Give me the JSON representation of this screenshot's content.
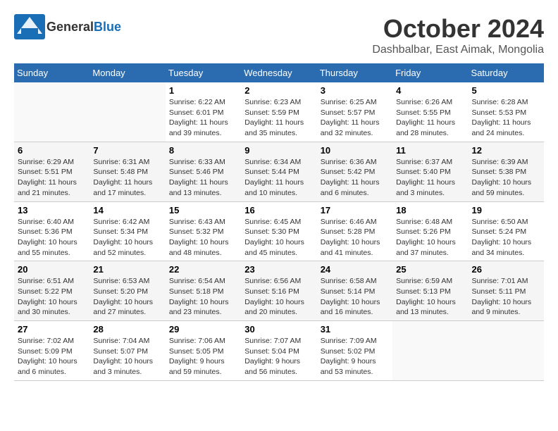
{
  "logo": {
    "general": "General",
    "blue": "Blue"
  },
  "title": "October 2024",
  "location": "Dashbalbar, East Aimak, Mongolia",
  "days_header": [
    "Sunday",
    "Monday",
    "Tuesday",
    "Wednesday",
    "Thursday",
    "Friday",
    "Saturday"
  ],
  "weeks": [
    [
      {
        "day": "",
        "info": ""
      },
      {
        "day": "",
        "info": ""
      },
      {
        "day": "1",
        "info": "Sunrise: 6:22 AM\nSunset: 6:01 PM\nDaylight: 11 hours\nand 39 minutes."
      },
      {
        "day": "2",
        "info": "Sunrise: 6:23 AM\nSunset: 5:59 PM\nDaylight: 11 hours\nand 35 minutes."
      },
      {
        "day": "3",
        "info": "Sunrise: 6:25 AM\nSunset: 5:57 PM\nDaylight: 11 hours\nand 32 minutes."
      },
      {
        "day": "4",
        "info": "Sunrise: 6:26 AM\nSunset: 5:55 PM\nDaylight: 11 hours\nand 28 minutes."
      },
      {
        "day": "5",
        "info": "Sunrise: 6:28 AM\nSunset: 5:53 PM\nDaylight: 11 hours\nand 24 minutes."
      }
    ],
    [
      {
        "day": "6",
        "info": "Sunrise: 6:29 AM\nSunset: 5:51 PM\nDaylight: 11 hours\nand 21 minutes."
      },
      {
        "day": "7",
        "info": "Sunrise: 6:31 AM\nSunset: 5:48 PM\nDaylight: 11 hours\nand 17 minutes."
      },
      {
        "day": "8",
        "info": "Sunrise: 6:33 AM\nSunset: 5:46 PM\nDaylight: 11 hours\nand 13 minutes."
      },
      {
        "day": "9",
        "info": "Sunrise: 6:34 AM\nSunset: 5:44 PM\nDaylight: 11 hours\nand 10 minutes."
      },
      {
        "day": "10",
        "info": "Sunrise: 6:36 AM\nSunset: 5:42 PM\nDaylight: 11 hours\nand 6 minutes."
      },
      {
        "day": "11",
        "info": "Sunrise: 6:37 AM\nSunset: 5:40 PM\nDaylight: 11 hours\nand 3 minutes."
      },
      {
        "day": "12",
        "info": "Sunrise: 6:39 AM\nSunset: 5:38 PM\nDaylight: 10 hours\nand 59 minutes."
      }
    ],
    [
      {
        "day": "13",
        "info": "Sunrise: 6:40 AM\nSunset: 5:36 PM\nDaylight: 10 hours\nand 55 minutes."
      },
      {
        "day": "14",
        "info": "Sunrise: 6:42 AM\nSunset: 5:34 PM\nDaylight: 10 hours\nand 52 minutes."
      },
      {
        "day": "15",
        "info": "Sunrise: 6:43 AM\nSunset: 5:32 PM\nDaylight: 10 hours\nand 48 minutes."
      },
      {
        "day": "16",
        "info": "Sunrise: 6:45 AM\nSunset: 5:30 PM\nDaylight: 10 hours\nand 45 minutes."
      },
      {
        "day": "17",
        "info": "Sunrise: 6:46 AM\nSunset: 5:28 PM\nDaylight: 10 hours\nand 41 minutes."
      },
      {
        "day": "18",
        "info": "Sunrise: 6:48 AM\nSunset: 5:26 PM\nDaylight: 10 hours\nand 37 minutes."
      },
      {
        "day": "19",
        "info": "Sunrise: 6:50 AM\nSunset: 5:24 PM\nDaylight: 10 hours\nand 34 minutes."
      }
    ],
    [
      {
        "day": "20",
        "info": "Sunrise: 6:51 AM\nSunset: 5:22 PM\nDaylight: 10 hours\nand 30 minutes."
      },
      {
        "day": "21",
        "info": "Sunrise: 6:53 AM\nSunset: 5:20 PM\nDaylight: 10 hours\nand 27 minutes."
      },
      {
        "day": "22",
        "info": "Sunrise: 6:54 AM\nSunset: 5:18 PM\nDaylight: 10 hours\nand 23 minutes."
      },
      {
        "day": "23",
        "info": "Sunrise: 6:56 AM\nSunset: 5:16 PM\nDaylight: 10 hours\nand 20 minutes."
      },
      {
        "day": "24",
        "info": "Sunrise: 6:58 AM\nSunset: 5:14 PM\nDaylight: 10 hours\nand 16 minutes."
      },
      {
        "day": "25",
        "info": "Sunrise: 6:59 AM\nSunset: 5:13 PM\nDaylight: 10 hours\nand 13 minutes."
      },
      {
        "day": "26",
        "info": "Sunrise: 7:01 AM\nSunset: 5:11 PM\nDaylight: 10 hours\nand 9 minutes."
      }
    ],
    [
      {
        "day": "27",
        "info": "Sunrise: 7:02 AM\nSunset: 5:09 PM\nDaylight: 10 hours\nand 6 minutes."
      },
      {
        "day": "28",
        "info": "Sunrise: 7:04 AM\nSunset: 5:07 PM\nDaylight: 10 hours\nand 3 minutes."
      },
      {
        "day": "29",
        "info": "Sunrise: 7:06 AM\nSunset: 5:05 PM\nDaylight: 9 hours\nand 59 minutes."
      },
      {
        "day": "30",
        "info": "Sunrise: 7:07 AM\nSunset: 5:04 PM\nDaylight: 9 hours\nand 56 minutes."
      },
      {
        "day": "31",
        "info": "Sunrise: 7:09 AM\nSunset: 5:02 PM\nDaylight: 9 hours\nand 53 minutes."
      },
      {
        "day": "",
        "info": ""
      },
      {
        "day": "",
        "info": ""
      }
    ]
  ]
}
